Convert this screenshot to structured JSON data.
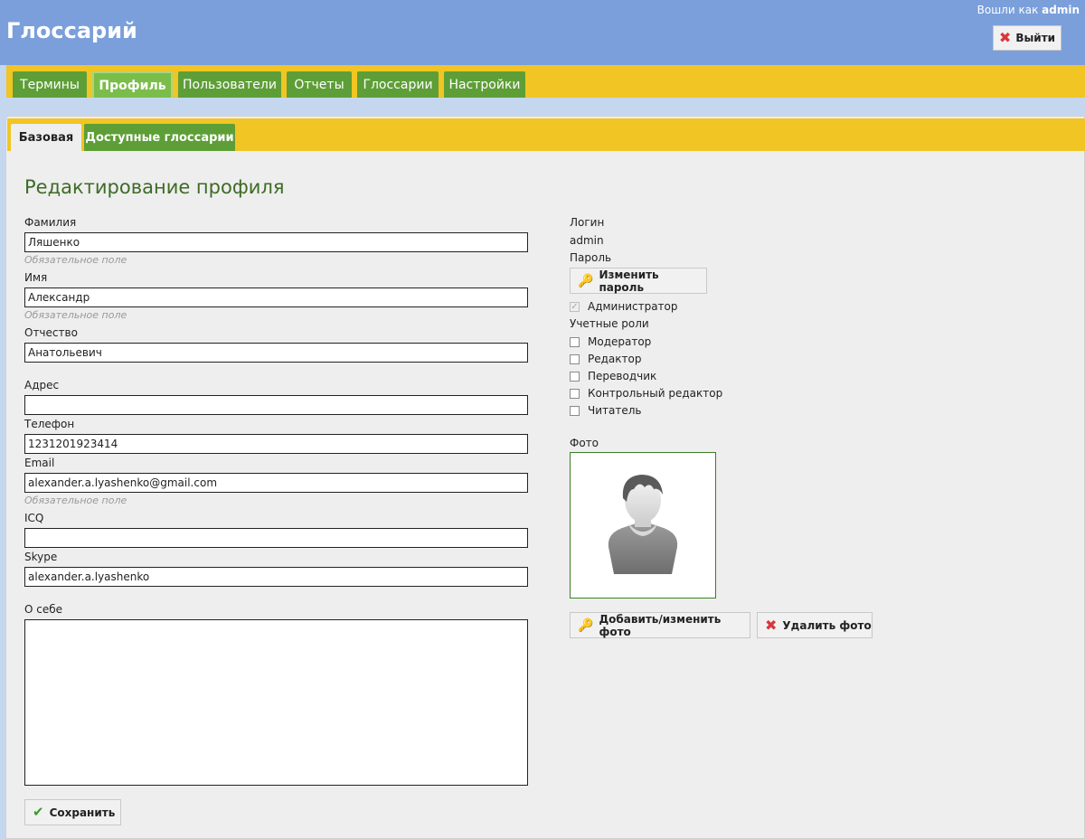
{
  "header": {
    "title": "Глоссарий",
    "logged_in_prefix": "Вошли как",
    "username": "admin",
    "logout_label": "Выйти",
    "logout_icon": "close-icon"
  },
  "main_tabs": [
    {
      "label": "Термины",
      "active": false
    },
    {
      "label": "Профиль",
      "active": true
    },
    {
      "label": "Пользователи",
      "active": false
    },
    {
      "label": "Отчеты",
      "active": false
    },
    {
      "label": "Глоссарии",
      "active": false
    },
    {
      "label": "Настройки",
      "active": false
    }
  ],
  "sub_tabs": [
    {
      "label": "Базовая",
      "active": true
    },
    {
      "label": "Доступные глоссарии",
      "active": false
    }
  ],
  "page_title": "Редактирование профиля",
  "form": {
    "last_name": {
      "label": "Фамилия",
      "value": "Ляшенко",
      "hint": "Обязательное поле"
    },
    "first_name": {
      "label": "Имя",
      "value": "Александр",
      "hint": "Обязательное поле"
    },
    "patronymic": {
      "label": "Отчество",
      "value": "Анатольевич"
    },
    "address": {
      "label": "Адрес",
      "value": ""
    },
    "phone": {
      "label": "Телефон",
      "value": "1231201923414"
    },
    "email": {
      "label": "Email",
      "value": "alexander.a.lyashenko@gmail.com",
      "hint": "Обязательное поле"
    },
    "icq": {
      "label": "ICQ",
      "value": ""
    },
    "skype": {
      "label": "Skype",
      "value": "alexander.a.lyashenko"
    },
    "about": {
      "label": "О себе",
      "value": ""
    },
    "save_label": "Сохранить"
  },
  "account": {
    "login_label": "Логин",
    "login_value": "admin",
    "password_label": "Пароль",
    "change_password_label": "Изменить пароль",
    "admin_label": "Администратор",
    "admin_checked": true,
    "roles_label": "Учетные роли",
    "roles": [
      {
        "label": "Модератор",
        "checked": false
      },
      {
        "label": "Редактор",
        "checked": false
      },
      {
        "label": "Переводчик",
        "checked": false
      },
      {
        "label": "Контрольный редактор",
        "checked": false
      },
      {
        "label": "Читатель",
        "checked": false
      }
    ],
    "photo_label": "Фото",
    "add_photo_label": "Добавить/изменить фото",
    "delete_photo_label": "Удалить фото"
  },
  "colors": {
    "header_bg": "#7a9fdb",
    "nav_bg": "#f1c523",
    "tab_green": "#5e9e37",
    "tab_active": "#7bbd4a",
    "title_green": "#3e6b25"
  }
}
